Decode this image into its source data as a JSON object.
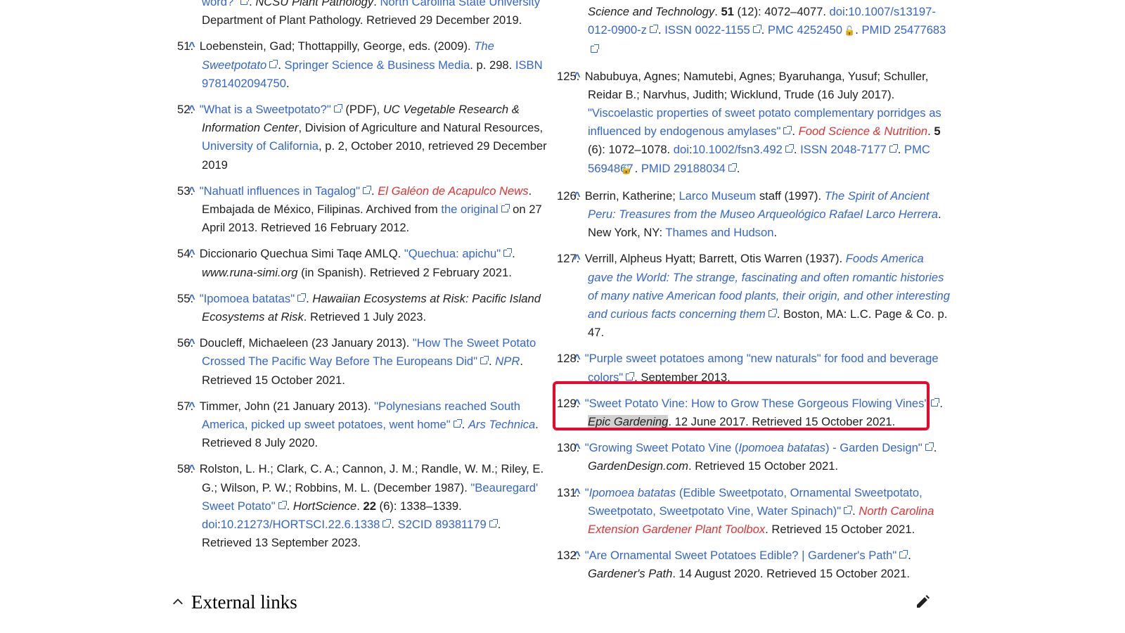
{
  "left_refs": [
    {
      "num": "",
      "parts": [
        {
          "t": "word?\"",
          "c": "lnk"
        },
        {
          "ext": true
        },
        {
          "t": ". "
        },
        {
          "t": "NCSU Plant Pathology",
          "c": "it"
        },
        {
          "t": ". "
        },
        {
          "t": "North Carolina State University",
          "c": "lnk"
        },
        {
          "t": " Department of Plant Pathology. Retrieved 29 December 2019."
        }
      ]
    },
    {
      "num": "51.",
      "parts": [
        {
          "t": "Loebenstein, Gad; Thottappilly, George, eds. (2009). "
        },
        {
          "t": "The Sweetpotato",
          "c": "lnk it"
        },
        {
          "ext": true
        },
        {
          "t": ". "
        },
        {
          "t": "Springer Science & Business Media",
          "c": "lnk"
        },
        {
          "t": ". p. 298. "
        },
        {
          "t": "ISBN",
          "c": "lnk"
        },
        {
          "t": " "
        },
        {
          "t": "9781402094750",
          "c": "lnk"
        },
        {
          "t": "."
        }
      ]
    },
    {
      "num": "52.",
      "parts": [
        {
          "t": "\"What is a Sweetpotato?\"",
          "c": "lnk"
        },
        {
          "ext": true
        },
        {
          "t": " (PDF), "
        },
        {
          "t": "UC Vegetable Research & Information Center",
          "c": "it"
        },
        {
          "t": ", Division of Agriculture and Natural Resources, "
        },
        {
          "t": "University of California",
          "c": "lnk"
        },
        {
          "t": ", p. 2, October 2010, retrieved 29 December 2019"
        }
      ]
    },
    {
      "num": "53.",
      "parts": [
        {
          "t": "\"Nahuatl influences in Tagalog\"",
          "c": "lnk"
        },
        {
          "ext": true
        },
        {
          "t": ". "
        },
        {
          "t": "El Galéon de Acapulco News",
          "c": "red it"
        },
        {
          "t": ". Embajada de México, Filipinas. Archived from "
        },
        {
          "t": "the original",
          "c": "lnk"
        },
        {
          "ext": true
        },
        {
          "t": " on 27 April 2013. Retrieved 16 February 2012."
        }
      ]
    },
    {
      "num": "54.",
      "parts": [
        {
          "t": "Diccionario Quechua Simi Taqe AMLQ. "
        },
        {
          "t": "\"Quechua: apichu\"",
          "c": "lnk"
        },
        {
          "ext": true
        },
        {
          "t": ". "
        },
        {
          "t": "www.runa-simi.org",
          "c": "it"
        },
        {
          "t": " (in Spanish). Retrieved 2 February 2021."
        }
      ]
    },
    {
      "num": "55.",
      "parts": [
        {
          "t": "\"Ipomoea batatas\"",
          "c": "lnk"
        },
        {
          "ext": true
        },
        {
          "t": ". "
        },
        {
          "t": "Hawaiian Ecosystems at Risk: Pacific Island Ecosystems at Risk",
          "c": "it"
        },
        {
          "t": ". Retrieved 1 July 2023."
        }
      ]
    },
    {
      "num": "56.",
      "parts": [
        {
          "t": "Doucleff, Michaeleen (23 January 2013). "
        },
        {
          "t": "\"How The Sweet Potato Crossed The Pacific Way Before The Europeans Did\"",
          "c": "lnk"
        },
        {
          "ext": true
        },
        {
          "t": ". "
        },
        {
          "t": "NPR",
          "c": "lnk it"
        },
        {
          "t": ". Retrieved 15 October 2021."
        }
      ]
    },
    {
      "num": "57.",
      "parts": [
        {
          "t": "Timmer, John (21 January 2013). "
        },
        {
          "t": "\"Polynesians reached South America, picked up sweet potatoes, went home\"",
          "c": "lnk"
        },
        {
          "ext": true
        },
        {
          "t": ". "
        },
        {
          "t": "Ars Technica",
          "c": "lnk it"
        },
        {
          "t": ". Retrieved 8 July 2020."
        }
      ]
    },
    {
      "num": "58.",
      "parts": [
        {
          "t": "Rolston, L. H.; Clark, C. A.; Cannon, J. M.; Randle, W. M.; Riley, E. G.; Wilson, P. W.; Robbins, M. L. (December 1987). "
        },
        {
          "t": "\"Beauregard' Sweet Potato\"",
          "c": "lnk"
        },
        {
          "ext": true
        },
        {
          "t": ". "
        },
        {
          "t": "HortScience",
          "c": "it"
        },
        {
          "t": ". "
        },
        {
          "t": "22",
          "c": "b"
        },
        {
          "t": " (6): 1338–1339. "
        },
        {
          "t": "doi",
          "c": "lnk"
        },
        {
          "t": ":"
        },
        {
          "t": "10.21273/HORTSCI.22.6.1338",
          "c": "lnk"
        },
        {
          "ext": true
        },
        {
          "t": ". "
        },
        {
          "t": "S2CID",
          "c": "lnk"
        },
        {
          "t": " "
        },
        {
          "t": "89381179",
          "c": "lnk"
        },
        {
          "ext": true
        },
        {
          "t": ". Retrieved 13 September 2023."
        }
      ]
    }
  ],
  "right_refs": [
    {
      "num": "",
      "parts": [
        {
          "t": "Science and Technology",
          "c": "it"
        },
        {
          "t": ". "
        },
        {
          "t": "51",
          "c": "b"
        },
        {
          "t": " (12): 4072–4077. "
        },
        {
          "t": "doi",
          "c": "lnk"
        },
        {
          "t": ":"
        },
        {
          "t": "10.1007/s13197-012-0900-z",
          "c": "lnk"
        },
        {
          "ext": true
        },
        {
          "t": ". "
        },
        {
          "t": "ISSN",
          "c": "lnk"
        },
        {
          "t": " "
        },
        {
          "t": "0022-1155",
          "c": "lnk"
        },
        {
          "ext": true
        },
        {
          "t": ". "
        },
        {
          "t": "PMC",
          "c": "lnk"
        },
        {
          "t": " "
        },
        {
          "t": "4252450",
          "c": "lnk"
        },
        {
          "lock": true
        },
        {
          "t": ". "
        },
        {
          "t": "PMID",
          "c": "lnk"
        },
        {
          "t": " "
        },
        {
          "t": "25477683",
          "c": "lnk"
        },
        {
          "ext": true
        }
      ]
    },
    {
      "num": "125.",
      "parts": [
        {
          "t": "Nabubuya, Agnes; Namutebi, Agnes; Byaruhanga, Yusuf; Schuller, Reidar B.; Narvhus, Judith; Wicklund, Trude (16 July 2017). "
        },
        {
          "t": "\"Viscoelastic properties of sweet potato complementary porridges as influenced by endogenous amylases\"",
          "c": "lnk"
        },
        {
          "ext": true
        },
        {
          "t": ". "
        },
        {
          "t": "Food Science & Nutrition",
          "c": "red it"
        },
        {
          "t": ". "
        },
        {
          "t": "5",
          "c": "b"
        },
        {
          "t": " (6): 1072–1078. "
        },
        {
          "t": "doi",
          "c": "lnk"
        },
        {
          "t": ":"
        },
        {
          "t": "10.1002/fsn3.492",
          "c": "lnk"
        },
        {
          "ext": true
        },
        {
          "t": ". "
        },
        {
          "t": "ISSN",
          "c": "lnk"
        },
        {
          "t": " "
        },
        {
          "t": "2048-7177",
          "c": "lnk"
        },
        {
          "ext": true
        },
        {
          "t": ". "
        },
        {
          "t": "PMC",
          "c": "lnk"
        },
        {
          "t": " "
        },
        {
          "t": "5694867",
          "c": "lnk"
        },
        {
          "lock": true
        },
        {
          "t": ". "
        },
        {
          "t": "PMID",
          "c": "lnk"
        },
        {
          "t": " "
        },
        {
          "t": "29188034",
          "c": "lnk"
        },
        {
          "ext": true
        },
        {
          "t": "."
        }
      ]
    },
    {
      "num": "126.",
      "parts": [
        {
          "t": "Berrin, Katherine; "
        },
        {
          "t": "Larco Museum",
          "c": "lnk"
        },
        {
          "t": " staff (1997). "
        },
        {
          "t": "The Spirit of Ancient Peru: Treasures from the Museo Arqueológico Rafael Larco Herrera",
          "c": "lnk it"
        },
        {
          "t": ". New York, NY: "
        },
        {
          "t": "Thames and Hudson",
          "c": "lnk"
        },
        {
          "t": "."
        }
      ]
    },
    {
      "num": "127.",
      "parts": [
        {
          "t": "Verrill, Alpheus Hyatt; Barrett, Otis Warren (1937). "
        },
        {
          "t": "Foods America gave the World: The strange, fascinating and often romantic histories of many native American food plants, their origin, and other interesting and curious facts concerning them",
          "c": "lnk it"
        },
        {
          "ext": true
        },
        {
          "t": ". Boston, MA: L.C. Page & Co. p. 47."
        }
      ]
    },
    {
      "num": "128.",
      "parts": [
        {
          "t": "\"Purple sweet potatoes among \"new naturals\" for food and beverage colors\"",
          "c": "lnk"
        },
        {
          "ext": true
        },
        {
          "t": ". September 2013."
        }
      ]
    },
    {
      "num": "129.",
      "parts": [
        {
          "t": "\"Sweet Potato Vine: How to Grow These Gorgeous Flowing Vines\"",
          "c": "lnk"
        },
        {
          "ext": true
        },
        {
          "t": ". "
        },
        {
          "t": "Epic Gardening",
          "c": "it hl"
        },
        {
          "t": ". 12 June 2017. Retrieved 15 October 2021."
        }
      ]
    },
    {
      "num": "130.",
      "parts": [
        {
          "t": "\"Growing Sweet Potato Vine (",
          "c": "lnk"
        },
        {
          "t": "Ipomoea batatas",
          "c": "lnk it"
        },
        {
          "t": ") - Garden Design\"",
          "c": "lnk"
        },
        {
          "ext": true
        },
        {
          "t": ". "
        },
        {
          "t": "GardenDesign.com",
          "c": "it"
        },
        {
          "t": ". Retrieved 15 October 2021."
        }
      ]
    },
    {
      "num": "131.",
      "parts": [
        {
          "t": "\"",
          "c": "lnk"
        },
        {
          "t": "Ipomoea batatas",
          "c": "lnk it"
        },
        {
          "t": " (Edible Sweetpotato, Ornamental Sweetpotato, Sweetpotato, Sweetpotato Vine, Water Spinach)\"",
          "c": "lnk"
        },
        {
          "ext": true
        },
        {
          "t": ". "
        },
        {
          "t": "North Carolina Extension Gardener Plant Toolbox",
          "c": "red it"
        },
        {
          "t": ". Retrieved 15 October 2021."
        }
      ]
    },
    {
      "num": "132.",
      "parts": [
        {
          "t": "\"Are Ornamental Sweet Potatoes Edible? | Gardener's Path\"",
          "c": "lnk"
        },
        {
          "ext": true
        },
        {
          "t": ". "
        },
        {
          "t": "Gardener's Path",
          "c": "it"
        },
        {
          "t": ". 14 August 2020. Retrieved 15 October 2021."
        }
      ]
    }
  ],
  "section": {
    "title": "External links"
  },
  "caret": "^",
  "colors": {
    "link": "#3366cc",
    "redlink": "#d33",
    "highlight_box": "#e8072f",
    "text": "#202122"
  }
}
